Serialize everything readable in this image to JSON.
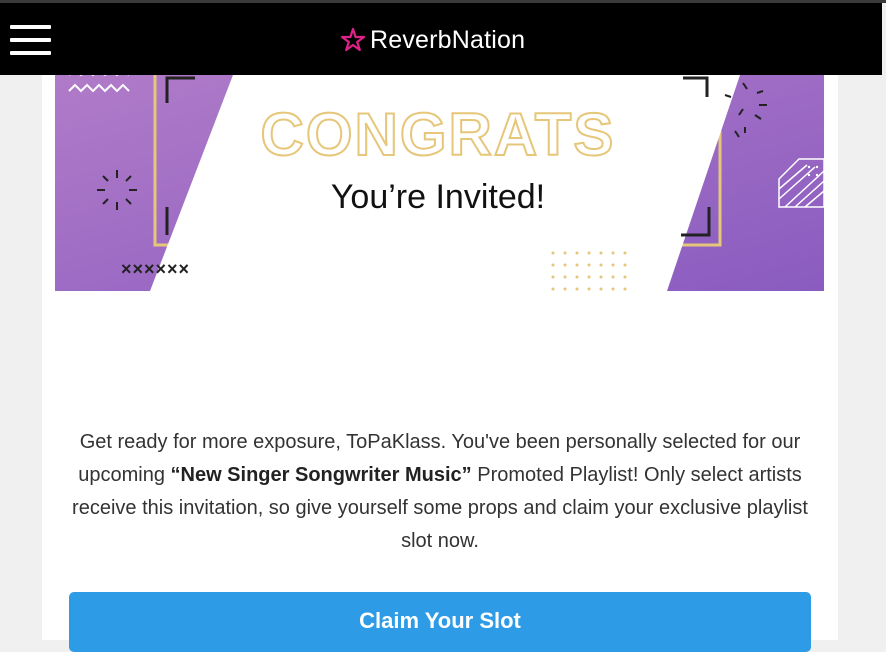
{
  "header": {
    "brand": "ReverbNation",
    "menu_icon": "hamburger-menu-icon",
    "logo_icon": "star-icon",
    "background": "#000000",
    "brand_color": "#e0218a"
  },
  "banner": {
    "headline": "CONGRATS",
    "subheadline": "You’re Invited!",
    "decor_marks": "××××××",
    "colors": {
      "purple": "#9b6fc4",
      "gold": "#e6c77a",
      "white": "#ffffff"
    }
  },
  "message": {
    "before": "Get ready for more exposure, ToPaKlass. You've been personally selected for our upcoming ",
    "bold": "“New Singer Songwriter Music”",
    "after": " Promoted Playlist! Only select artists receive this invitation, so give yourself some props and claim your exclusive playlist slot now."
  },
  "cta": {
    "label": "Claim Your Slot",
    "color": "#2d9be5"
  }
}
